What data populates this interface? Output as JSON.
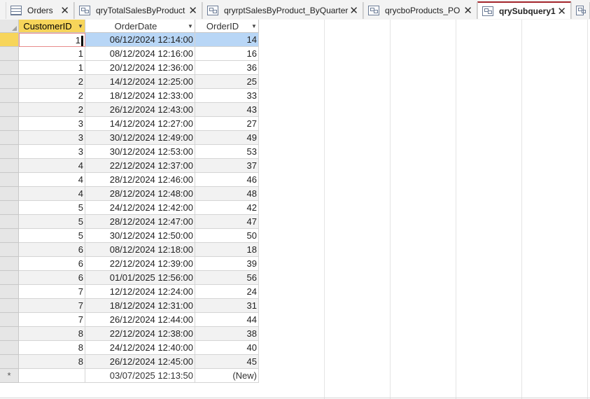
{
  "tabs": [
    {
      "label": "Orders",
      "icon": "table-icon",
      "active": false
    },
    {
      "label": "qryTotalSalesByProduct",
      "icon": "query-icon",
      "active": false
    },
    {
      "label": "qryrptSalesByProduct_ByQuarter",
      "icon": "query-icon",
      "active": false
    },
    {
      "label": "qrycboProducts_PO",
      "icon": "query-icon",
      "active": false
    },
    {
      "label": "qrySubquery1",
      "icon": "query-icon",
      "active": true
    }
  ],
  "columns": [
    "CustomerID",
    "OrderDate",
    "OrderID"
  ],
  "rows": [
    {
      "customer_id": "1",
      "order_date": "06/12/2024 12:14:00",
      "order_id": "14"
    },
    {
      "customer_id": "1",
      "order_date": "08/12/2024 12:16:00",
      "order_id": "16"
    },
    {
      "customer_id": "1",
      "order_date": "20/12/2024 12:36:00",
      "order_id": "36"
    },
    {
      "customer_id": "2",
      "order_date": "14/12/2024 12:25:00",
      "order_id": "25"
    },
    {
      "customer_id": "2",
      "order_date": "18/12/2024 12:33:00",
      "order_id": "33"
    },
    {
      "customer_id": "2",
      "order_date": "26/12/2024 12:43:00",
      "order_id": "43"
    },
    {
      "customer_id": "3",
      "order_date": "14/12/2024 12:27:00",
      "order_id": "27"
    },
    {
      "customer_id": "3",
      "order_date": "30/12/2024 12:49:00",
      "order_id": "49"
    },
    {
      "customer_id": "3",
      "order_date": "30/12/2024 12:53:00",
      "order_id": "53"
    },
    {
      "customer_id": "4",
      "order_date": "22/12/2024 12:37:00",
      "order_id": "37"
    },
    {
      "customer_id": "4",
      "order_date": "28/12/2024 12:46:00",
      "order_id": "46"
    },
    {
      "customer_id": "4",
      "order_date": "28/12/2024 12:48:00",
      "order_id": "48"
    },
    {
      "customer_id": "5",
      "order_date": "24/12/2024 12:42:00",
      "order_id": "42"
    },
    {
      "customer_id": "5",
      "order_date": "28/12/2024 12:47:00",
      "order_id": "47"
    },
    {
      "customer_id": "5",
      "order_date": "30/12/2024 12:50:00",
      "order_id": "50"
    },
    {
      "customer_id": "6",
      "order_date": "08/12/2024 12:18:00",
      "order_id": "18"
    },
    {
      "customer_id": "6",
      "order_date": "22/12/2024 12:39:00",
      "order_id": "39"
    },
    {
      "customer_id": "6",
      "order_date": "01/01/2025 12:56:00",
      "order_id": "56"
    },
    {
      "customer_id": "7",
      "order_date": "12/12/2024 12:24:00",
      "order_id": "24"
    },
    {
      "customer_id": "7",
      "order_date": "18/12/2024 12:31:00",
      "order_id": "31"
    },
    {
      "customer_id": "7",
      "order_date": "26/12/2024 12:44:00",
      "order_id": "44"
    },
    {
      "customer_id": "8",
      "order_date": "22/12/2024 12:38:00",
      "order_id": "38"
    },
    {
      "customer_id": "8",
      "order_date": "24/12/2024 12:40:00",
      "order_id": "40"
    },
    {
      "customer_id": "8",
      "order_date": "26/12/2024 12:45:00",
      "order_id": "45"
    }
  ],
  "new_row": {
    "marker": "*",
    "customer_id": "",
    "order_date": "03/07/2025 12:13:50",
    "order_id": "(New)"
  },
  "colors": {
    "active_tab_accent": "#a4262c",
    "selected_header": "#f7d55a",
    "selected_cell": "#b8d6f6"
  }
}
